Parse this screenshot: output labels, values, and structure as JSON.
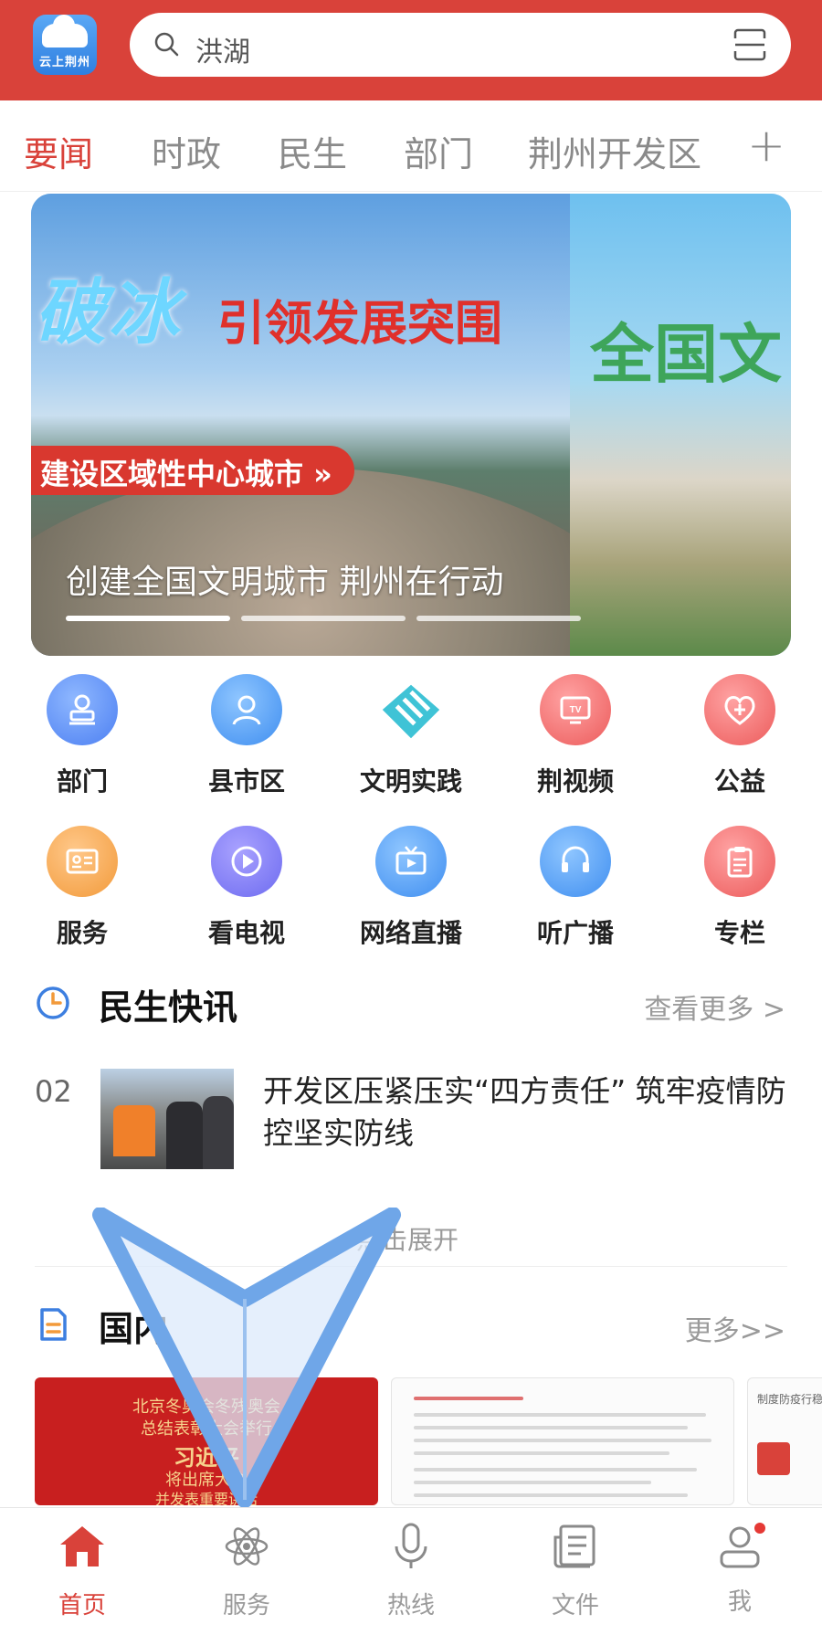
{
  "header": {
    "logo_text": "云上荆州",
    "search_placeholder": "洪湖",
    "icons": [
      "logo-icon",
      "search-icon",
      "scan-icon"
    ]
  },
  "tabs": {
    "items": [
      "要闻",
      "时政",
      "民生",
      "部门",
      "荆州开发区"
    ],
    "active": "要闻",
    "add_label": "+"
  },
  "banner": {
    "title": "破冰",
    "subtitle": "引领发展突围",
    "pill": "建设区域性中心城市 »",
    "caption": "创建全国文明城市 荆州在行动",
    "side_text": "全国文",
    "slide_count": 3,
    "active_slide": 1
  },
  "grid": {
    "row1": [
      {
        "label": "部门",
        "icon": "stamp-icon"
      },
      {
        "label": "县市区",
        "icon": "person-icon"
      },
      {
        "label": "文明实践",
        "icon": "heart-hand-icon"
      },
      {
        "label": "荆视频",
        "icon": "tv-icon"
      },
      {
        "label": "公益",
        "icon": "heart-plus-icon"
      }
    ],
    "row2": [
      {
        "label": "服务",
        "icon": "id-card-icon"
      },
      {
        "label": "看电视",
        "icon": "play-icon"
      },
      {
        "label": "网络直播",
        "icon": "live-camera-icon"
      },
      {
        "label": "听广播",
        "icon": "headset-icon"
      },
      {
        "label": "专栏",
        "icon": "clipboard-icon"
      }
    ]
  },
  "news_section": {
    "title": "民生快讯",
    "more": "查看更多 >",
    "icon": "clock-icon",
    "item": {
      "num": "02",
      "title": "开发区压紧压实“四方责任” 筑牢疫情防控坚实防线"
    },
    "expand": "点击展开"
  },
  "domestic_section": {
    "title": "国内",
    "more": "更多>>",
    "icon": "document-icon",
    "card1_lines": [
      "北京冬奥会冬残奥会",
      "总结表彰大会举行",
      "习近平",
      "将出席大会",
      "并发表重要讲话"
    ],
    "card3_title": "制度防疫行稳"
  },
  "bottom_nav": {
    "items": [
      {
        "label": "首页",
        "icon": "home-icon"
      },
      {
        "label": "服务",
        "icon": "atom-icon"
      },
      {
        "label": "热线",
        "icon": "microphone-icon"
      },
      {
        "label": "文件",
        "icon": "newspaper-icon"
      },
      {
        "label": "我",
        "icon": "user-icon"
      }
    ],
    "active": "首页"
  },
  "colors": {
    "brand_red": "#d9423a",
    "arrow_blue": "#6fa6e8"
  }
}
